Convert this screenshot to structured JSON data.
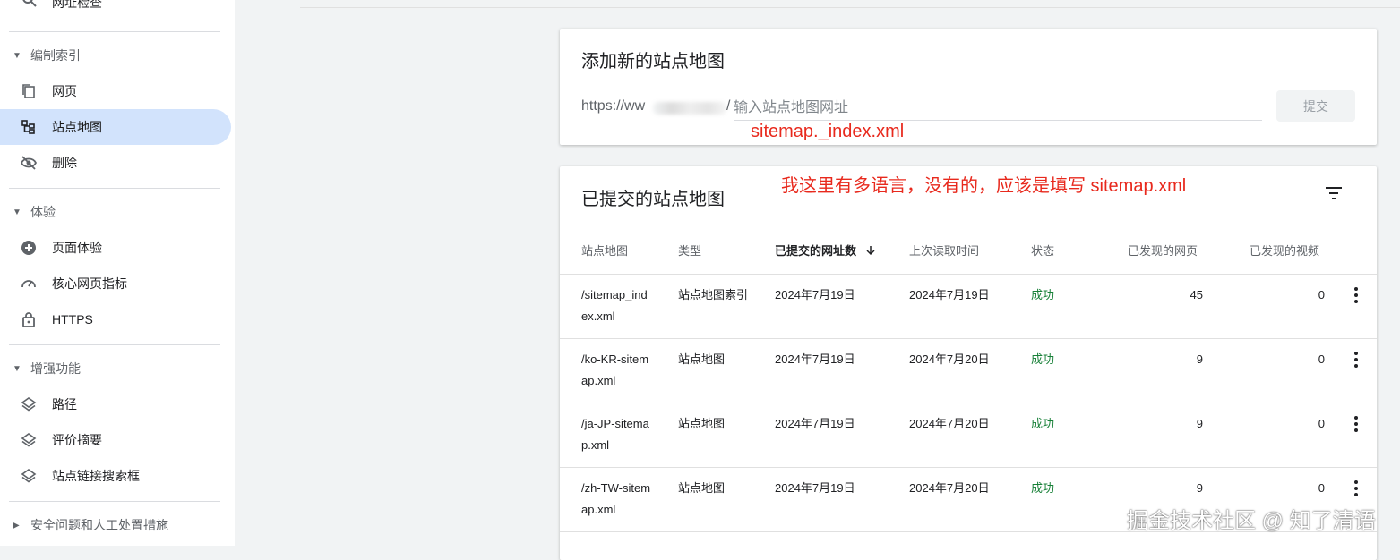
{
  "sidebar": {
    "top_item": {
      "label": "网址检查",
      "icon": "search-icon"
    },
    "sections": [
      {
        "header": "编制索引",
        "items": [
          {
            "label": "网页",
            "icon": "pages-icon"
          },
          {
            "label": "站点地图",
            "icon": "sitemap-icon",
            "active": true
          },
          {
            "label": "删除",
            "icon": "eye-off-icon"
          }
        ]
      },
      {
        "header": "体验",
        "items": [
          {
            "label": "页面体验",
            "icon": "plus-circle-icon"
          },
          {
            "label": "核心网页指标",
            "icon": "speedometer-icon"
          },
          {
            "label": "HTTPS",
            "icon": "lock-icon"
          }
        ]
      },
      {
        "header": "增强功能",
        "items": [
          {
            "label": "路径",
            "icon": "layers-icon"
          },
          {
            "label": "评价摘要",
            "icon": "layers-icon"
          },
          {
            "label": "站点链接搜索框",
            "icon": "layers-icon"
          }
        ]
      },
      {
        "header": "安全问题和人工处置措施",
        "collapsed": true
      }
    ]
  },
  "add_sitemap": {
    "title": "添加新的站点地图",
    "url_prefix": "https://ww",
    "url_prefix_tail": "/",
    "input_placeholder": "输入站点地图网址",
    "submit_label": "提交"
  },
  "annotations": {
    "note1": "sitemap._index.xml",
    "note2": "我这里有多语言，没有的，应该是填写 sitemap.xml"
  },
  "submitted": {
    "title": "已提交的站点地图",
    "columns": [
      "站点地图",
      "类型",
      "已提交的网址数",
      "上次读取时间",
      "状态",
      "已发现的网页",
      "已发现的视频"
    ],
    "sort_icon": "arrow-down-icon",
    "rows": [
      {
        "sitemap_l1": "/sitemap_ind",
        "sitemap_l2": "ex.xml",
        "type": "站点地图索引",
        "submitted": "2024年7月19日",
        "last_read": "2024年7月19日",
        "status": "成功",
        "pages": "45",
        "videos": "0"
      },
      {
        "sitemap_l1": "/ko-KR-sitem",
        "sitemap_l2": "ap.xml",
        "type": "站点地图",
        "submitted": "2024年7月19日",
        "last_read": "2024年7月20日",
        "status": "成功",
        "pages": "9",
        "videos": "0"
      },
      {
        "sitemap_l1": "/ja-JP-sitema",
        "sitemap_l2": "p.xml",
        "type": "站点地图",
        "submitted": "2024年7月19日",
        "last_read": "2024年7月20日",
        "status": "成功",
        "pages": "9",
        "videos": "0"
      },
      {
        "sitemap_l1": "/zh-TW-sitem",
        "sitemap_l2": "ap.xml",
        "type": "站点地图",
        "submitted": "2024年7月19日",
        "last_read": "2024年7月20日",
        "status": "成功",
        "pages": "9",
        "videos": "0"
      }
    ]
  },
  "watermark": "掘金技术社区 @ 知了清语",
  "colors": {
    "accent_active": "#d2e3fc",
    "success": "#188038",
    "annotation": "#e8291d"
  }
}
